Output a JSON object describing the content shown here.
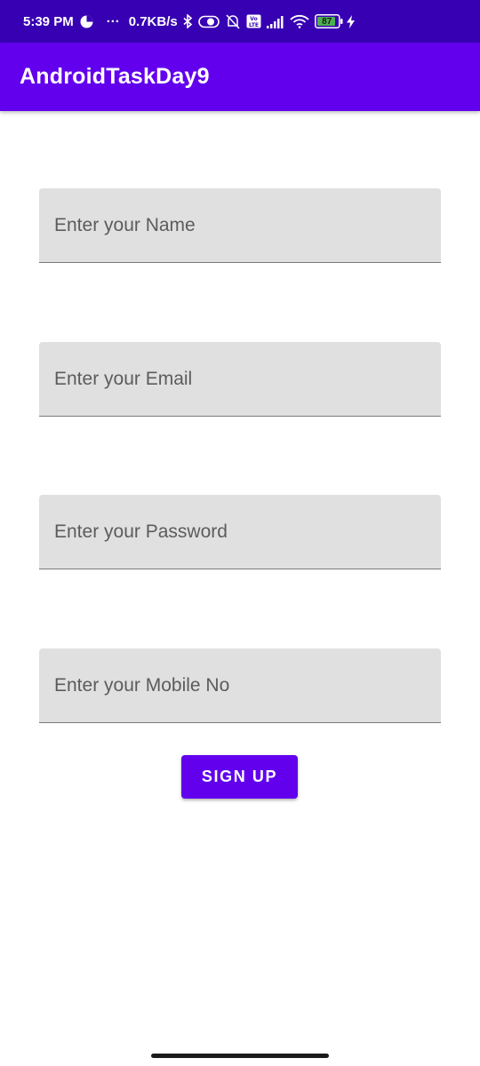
{
  "status_bar": {
    "time": "5:39 PM",
    "more_dots": "···",
    "net_speed": "0.7KB/s",
    "volte_label": "Vo LTE",
    "battery_level": "87",
    "icons": [
      "data-saver-icon",
      "bluetooth-icon",
      "eye-care-icon",
      "mute-icon",
      "volte-icon",
      "signal-icon",
      "wifi-icon",
      "battery-icon",
      "charging-icon"
    ]
  },
  "app_bar": {
    "title": "AndroidTaskDay9"
  },
  "form": {
    "name_placeholder": "Enter your Name",
    "email_placeholder": "Enter your Email",
    "password_placeholder": "Enter your Password",
    "mobile_placeholder": "Enter your Mobile No",
    "signup_label": "SIGN UP"
  },
  "colors": {
    "status_bar": "#3700B3",
    "primary": "#6200EE",
    "field_bg": "#E0E0E0"
  }
}
